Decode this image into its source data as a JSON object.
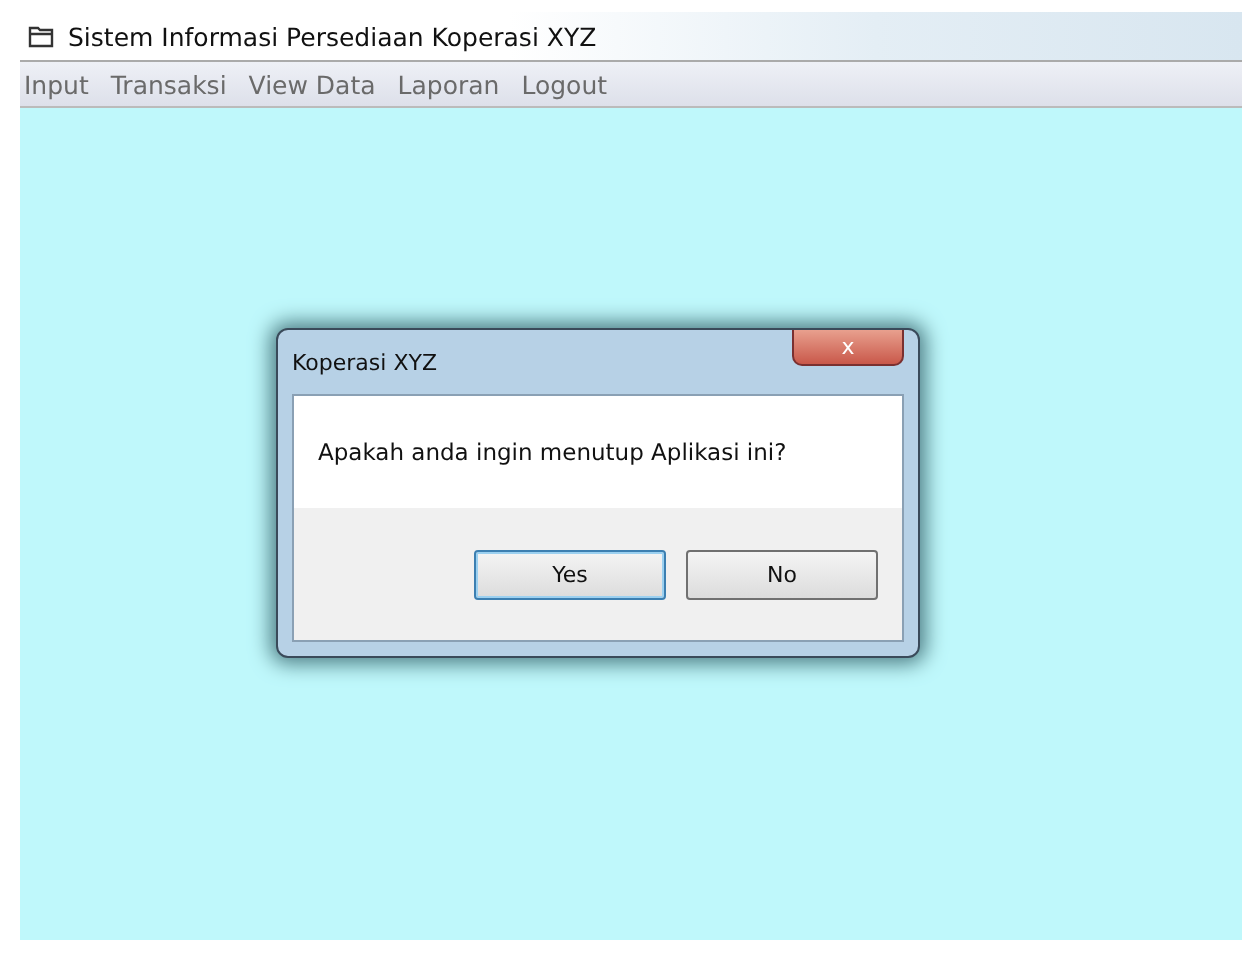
{
  "window": {
    "title": "Sistem Informasi Persediaan Koperasi XYZ"
  },
  "menu": [
    "Input",
    "Transaksi",
    "View Data",
    "Laporan",
    "Logout"
  ],
  "dialog": {
    "title": "Koperasi XYZ",
    "close": "x",
    "message": "Apakah anda ingin menutup Aplikasi ini?",
    "buttons": [
      {
        "label": "Yes",
        "selected": true
      },
      {
        "label": "No",
        "selected": false
      }
    ]
  }
}
